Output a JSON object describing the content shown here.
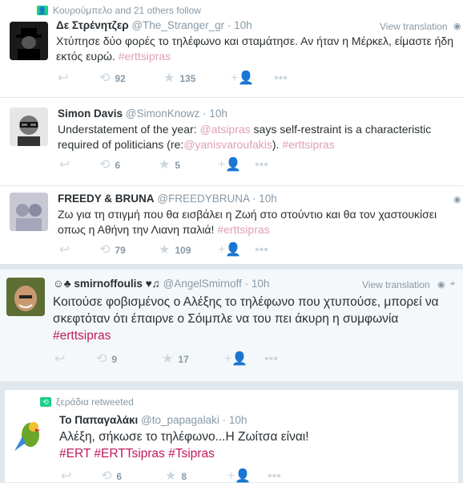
{
  "tweets": [
    {
      "context": "Κουρούμπελο and 21 others follow",
      "name": "Δε Στρένητζερ",
      "handle": "@The_Stranger_gr",
      "time": "· 10h",
      "view_translation": "View translation",
      "text_parts": [
        "Χτύπησε δύο φορές το τηλέφωνο και σταμάτησε. Αν ήταν η Μέρκελ, είμαστε ήδη εκτός ευρώ. "
      ],
      "hashtag": "#erttsipras",
      "retweets": "92",
      "likes": "135"
    },
    {
      "name": "Simon Davis",
      "handle": "@SimonKnowz",
      "time": "· 10h",
      "text_a": "Understatement of the year: ",
      "mention1": "@atsipras",
      "text_b": " says self-restraint is a characteristic required of politicians (re:",
      "mention2": "@yanisvaroufakis",
      "text_c": "). ",
      "hashtag": "#erttsipras",
      "retweets": "6",
      "likes": "5"
    },
    {
      "name": "FREEDY & BRUNA",
      "handle": "@FREEDYBRUNA",
      "time": "· 10h",
      "text": "Ζω για τη στιγμή που θα εισβάλει η Ζωή στο στούντιο και θα τον χαστουκίσει οπως η Αθήνη την Λιανη παλιά! ",
      "hashtag": "#erttsipras",
      "retweets": "79",
      "likes": "109"
    },
    {
      "name": "☺♣ smirnoffoulis ♥♫",
      "handle": "@AngelSmirnoff",
      "time": "· 10h",
      "view_translation": "View translation",
      "text": "Κοιτούσε φοβισμένος ο Αλέξης το τηλέφωνο που χτυπούσε, μπορεί να σκεφτόταν ότι έπαιρνε ο Σόιμπλε να του πει άκυρη η συμφωνία",
      "hashtag": "#erttsipras",
      "retweets": "9",
      "likes": "17"
    },
    {
      "context": "ξεράδια retweeted",
      "name": "Το Παπαγαλάκι",
      "handle": "@to_papagalaki",
      "time": "· 10h",
      "text": "Αλέξη, σήκωσε το τηλέφωνο...Η Ζωίτσα είναι!",
      "hashtags": "#ERT #ERTTsipras #Tsipras",
      "retweets": "6",
      "likes": "8"
    }
  ],
  "icons": {
    "reply": "↩",
    "retweet": "⟲",
    "like": "★",
    "follow": "+",
    "more": "•••",
    "globe": "◉"
  }
}
